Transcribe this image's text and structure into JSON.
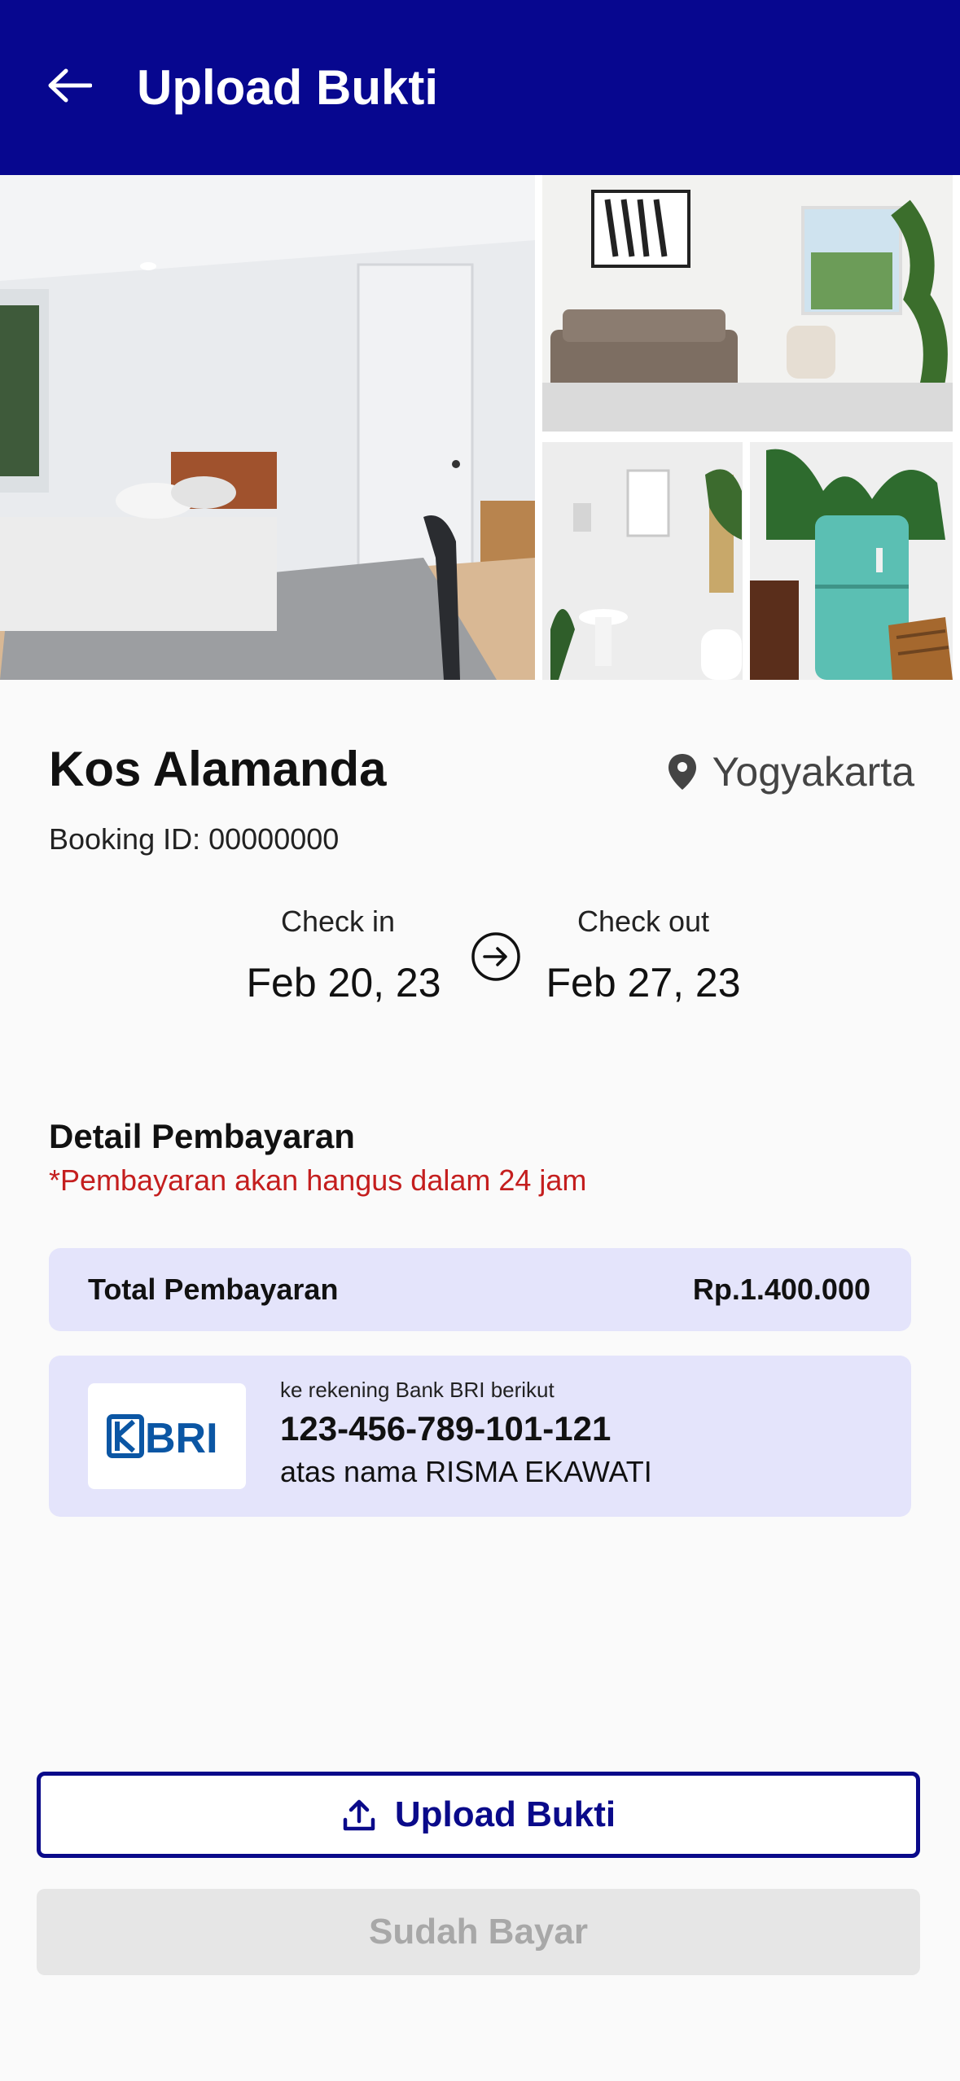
{
  "app_bar": {
    "title": "Upload Bukti",
    "back_icon": "arrow-left-icon",
    "background": "#07078F"
  },
  "gallery": {
    "photos": [
      "bedroom-photo",
      "living-room-photo",
      "bathroom-photo",
      "kitchen-photo"
    ]
  },
  "property": {
    "name": "Kos Alamanda",
    "location": "Yogyakarta",
    "location_icon": "map-pin-icon",
    "booking_id": "Booking ID: 00000000"
  },
  "stay": {
    "check_in_label": "Check in",
    "check_in_date": "Feb 20, 23",
    "check_out_label": "Check out",
    "check_out_date": "Feb 27, 23",
    "arrow_icon": "arrow-right-circle-icon"
  },
  "payment": {
    "title": "Detail Pembayaran",
    "warning": "*Pembayaran akan hangus dalam 24 jam",
    "warning_color": "#C41E1E",
    "total_label": "Total Pembayaran",
    "total_value": "Rp.1.400.000",
    "card_color": "#E4E4FB"
  },
  "bank": {
    "logo_text": "BRI",
    "logo_color": "#0B56A4",
    "caption": "ke rekening Bank BRI berikut",
    "account_number": "123-456-789-101-121",
    "account_holder": "atas nama RISMA EKAWATI"
  },
  "actions": {
    "upload_label": "Upload Bukti",
    "upload_icon": "upload-icon",
    "paid_label": "Sudah Bayar",
    "primary_color": "#0A0A8A"
  }
}
